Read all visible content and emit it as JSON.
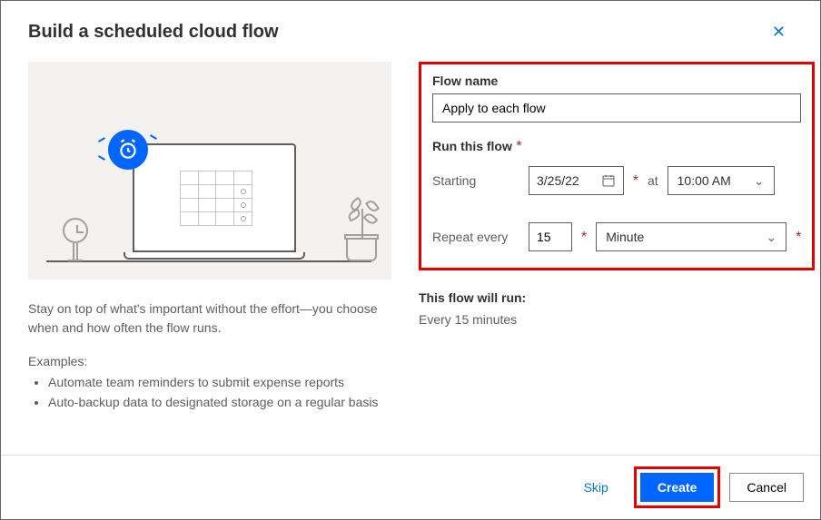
{
  "dialog": {
    "title": "Build a scheduled cloud flow"
  },
  "left": {
    "description": "Stay on top of what's important without the effort—you choose when and how often the flow runs.",
    "examples_label": "Examples:",
    "examples": [
      "Automate team reminders to submit expense reports",
      "Auto-backup data to designated storage on a regular basis"
    ]
  },
  "form": {
    "flow_name_label": "Flow name",
    "flow_name_value": "Apply to each flow",
    "run_label": "Run this flow",
    "starting_label": "Starting",
    "starting_date": "3/25/22",
    "at_label": "at",
    "starting_time": "10:00 AM",
    "repeat_label": "Repeat every",
    "repeat_value": "15",
    "repeat_unit": "Minute"
  },
  "summary": {
    "title": "This flow will run:",
    "text": "Every 15 minutes"
  },
  "footer": {
    "skip": "Skip",
    "create": "Create",
    "cancel": "Cancel"
  }
}
